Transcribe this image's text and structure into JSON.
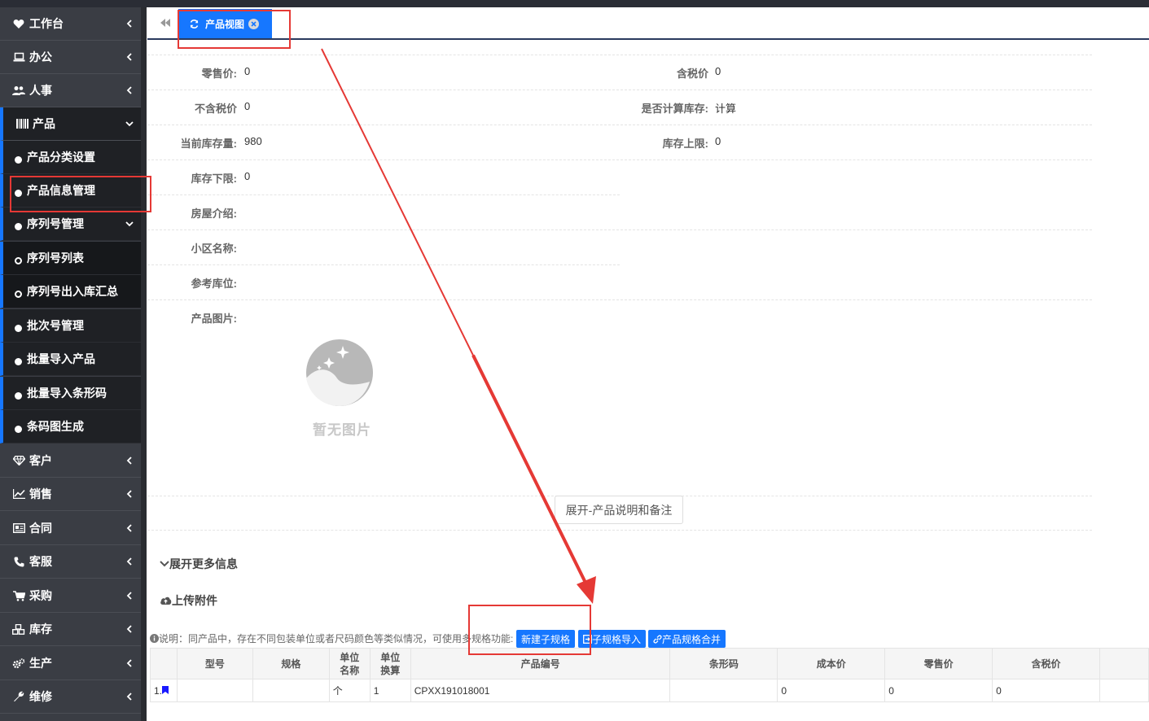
{
  "sidebar": {
    "items": [
      {
        "label": "工作台",
        "icon": "heart-icon"
      },
      {
        "label": "办公",
        "icon": "laptop-icon"
      },
      {
        "label": "人事",
        "icon": "users-icon"
      },
      {
        "label": "产品",
        "icon": "barcode-icon"
      },
      {
        "label": "客户",
        "icon": "diamond-icon"
      },
      {
        "label": "销售",
        "icon": "line-chart-icon"
      },
      {
        "label": "合同",
        "icon": "contract-icon"
      },
      {
        "label": "客服",
        "icon": "phone-icon"
      },
      {
        "label": "采购",
        "icon": "cart-icon"
      },
      {
        "label": "库存",
        "icon": "cubes-icon"
      },
      {
        "label": "生产",
        "icon": "cogs-icon"
      },
      {
        "label": "维修",
        "icon": "wrench-icon"
      }
    ],
    "product_sub": [
      {
        "label": "产品分类设置"
      },
      {
        "label": "产品信息管理"
      },
      {
        "label": "序列号管理"
      },
      {
        "label": "序列号列表"
      },
      {
        "label": "序列号出入库汇总"
      },
      {
        "label": "批次号管理"
      },
      {
        "label": "批量导入产品"
      },
      {
        "label": "批量导入条形码"
      },
      {
        "label": "条码图生成"
      }
    ]
  },
  "tabs": {
    "active_label": "产品视图"
  },
  "fields": {
    "retail_price": {
      "label": "零售价:",
      "value": "0"
    },
    "tax_incl_price": {
      "label": "含税价",
      "value": "0"
    },
    "tax_excl_price": {
      "label": "不含税价",
      "value": "0"
    },
    "calc_stock": {
      "label": "是否计算库存:",
      "value": "计算"
    },
    "current_stock": {
      "label": "当前库存量:",
      "value": "980"
    },
    "stock_upper": {
      "label": "库存上限:",
      "value": "0"
    },
    "stock_lower": {
      "label": "库存下限:",
      "value": "0"
    },
    "house_intro": {
      "label": "房屋介绍:",
      "value": ""
    },
    "community_name": {
      "label": "小区名称:",
      "value": ""
    },
    "ref_location": {
      "label": "参考库位:",
      "value": ""
    },
    "product_image": {
      "label": "产品图片:",
      "value": ""
    }
  },
  "no_image_text": "暂无图片",
  "expand_button": "展开-产品说明和备注",
  "more_info": "展开更多信息",
  "upload": "上传附件",
  "note": "说明：同产品中，存在不同包装单位或者尺码颜色等类似情况，可使用多规格功能:",
  "buttons": {
    "new_sub_spec": "新建子规格",
    "sub_spec_import": "子规格导入",
    "spec_merge": "产品规格合并"
  },
  "table": {
    "headers": [
      "",
      "型号",
      "规格",
      "单位\n名称",
      "单位\n换算",
      "产品编号",
      "条形码",
      "成本价",
      "零售价",
      "含税价"
    ],
    "rows": [
      {
        "index": "1.",
        "model": "",
        "spec": "",
        "unit": "个",
        "ratio": "1",
        "code": "CPXX191018001",
        "barcode": "",
        "cost": "0",
        "retail": "0",
        "tax_price": "0"
      }
    ]
  },
  "colors": {
    "accent": "#1677ff",
    "sidebar": "#3a3d44",
    "annotation": "#e53935"
  }
}
